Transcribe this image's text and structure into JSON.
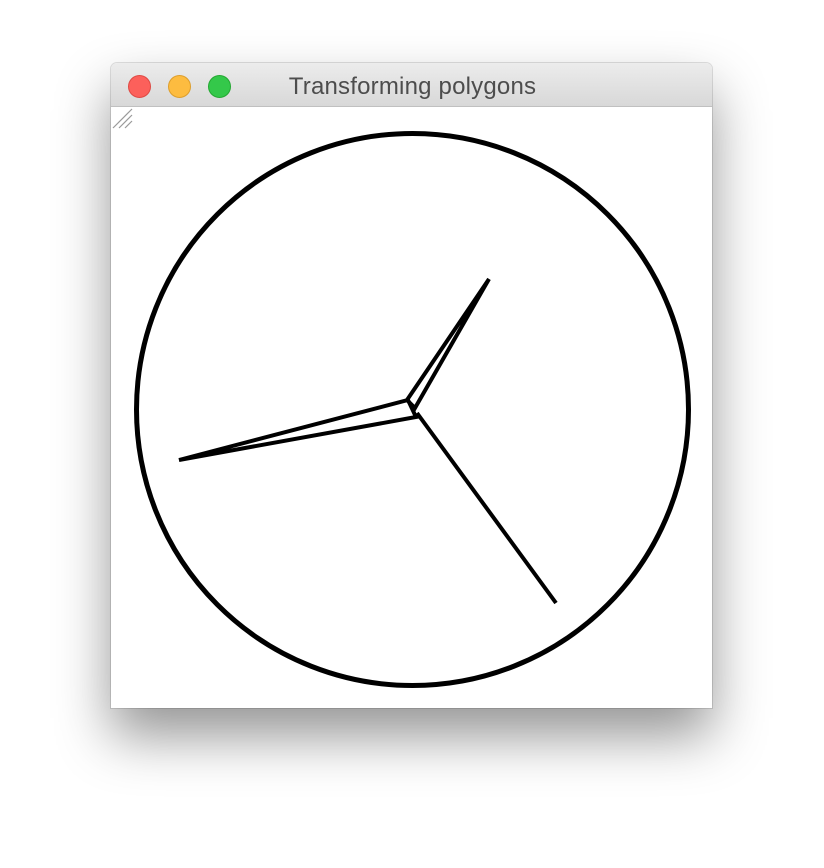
{
  "window": {
    "title": "Transforming polygons",
    "buttons": {
      "close": "close-button",
      "minimize": "minimize-button",
      "zoom": "zoom-button"
    },
    "colors": {
      "close": "#fc605b",
      "minimize": "#fdbc40",
      "zoom": "#34c84a",
      "stroke": "#000000",
      "background": "#ffffff"
    }
  }
}
